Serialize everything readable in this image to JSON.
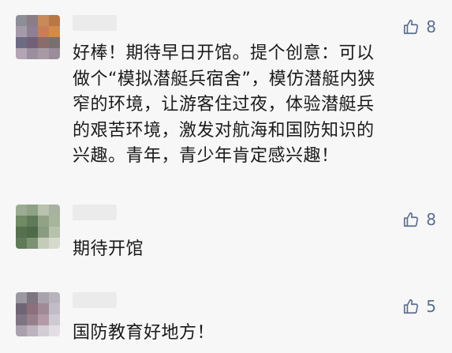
{
  "comments": [
    {
      "likes": "8",
      "text": "好棒！期待早日开馆。提个创意：可以\n做个“模拟潜艇兵宿舍”，模仿潜艇内狭\n窄的环境，让游客住过夜，体验潜艇兵\n的艰苦环境，激发对航海和国防知识的\n兴趣。青年，青少年肯定感兴趣！",
      "avatar_colors": [
        "#8d8f98",
        "#8a7d85",
        "#c98a5a",
        "#b87845",
        "#a59ba8",
        "#8f7f92",
        "#c97e5a",
        "#d48a48",
        "#6d6b84",
        "#735f77",
        "#8a6c6b",
        "#7a6f70",
        "#b3a5b4",
        "#9b8e9f",
        "#a89aa5",
        "#9b8c99"
      ]
    },
    {
      "likes": "8",
      "text": "期待开馆",
      "avatar_colors": [
        "#9cab94",
        "#8ea285",
        "#b8c2ae",
        "#a7b3a0",
        "#6f8a65",
        "#5f7a58",
        "#91a286",
        "#a7b59d",
        "#55704f",
        "#4f6a49",
        "#8a9c80",
        "#b6c2ab",
        "#607a58",
        "#7d9173",
        "#c4ccb9",
        "#d5dacc"
      ]
    },
    {
      "likes": "5",
      "text": "国防教育好地方！",
      "avatar_colors": [
        "#9b98a2",
        "#7d7582",
        "#a8a3ad",
        "#b8b3bd",
        "#6f6675",
        "#8b6f7b",
        "#a08a96",
        "#c2bcc6",
        "#7f7483",
        "#95808c",
        "#b39aa6",
        "#cfc9d2",
        "#a9a1ad",
        "#bdb3be",
        "#d2ccd4",
        "#e2dee3"
      ]
    }
  ]
}
